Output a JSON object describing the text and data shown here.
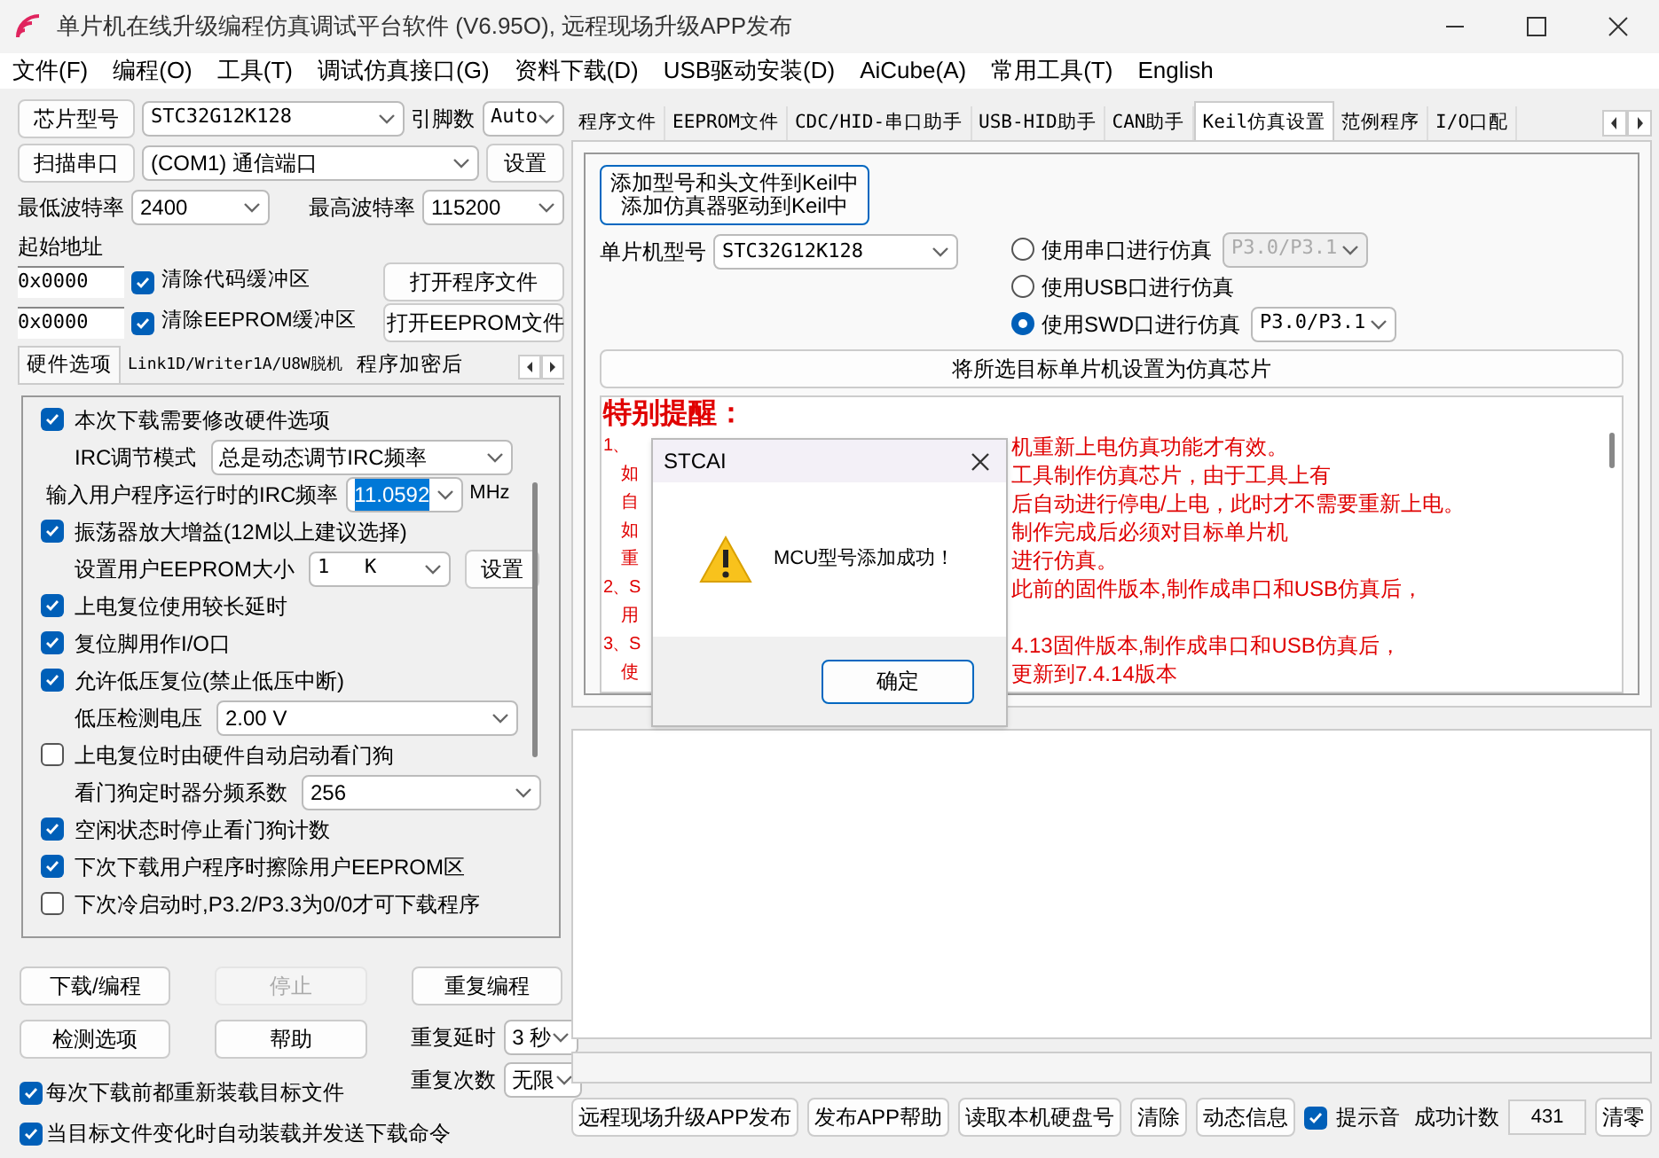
{
  "window": {
    "title": "单片机在线升级编程仿真调试平台软件 (V6.95O), 远程现场升级APP发布"
  },
  "menu": [
    "文件(F)",
    "编程(O)",
    "工具(T)",
    "调试仿真接口(G)",
    "资料下载(D)",
    "USB驱动安装(D)",
    "AiCube(A)",
    "常用工具(T)",
    "English"
  ],
  "chip": {
    "button": "芯片型号",
    "value": "STC32G12K128",
    "pins_label": "引脚数",
    "pins_value": "Auto"
  },
  "port": {
    "button": "扫描串口",
    "value": "(COM1) 通信端口",
    "settings": "设置"
  },
  "baud": {
    "min_label": "最低波特率",
    "min": "2400",
    "max_label": "最高波特率",
    "max": "115200"
  },
  "start_address": {
    "label": "起始地址",
    "rows": [
      {
        "value": "0x0000",
        "checked": true,
        "label": "清除代码缓冲区",
        "button": "打开程序文件"
      },
      {
        "value": "0x0000",
        "checked": true,
        "label": "清除EEPROM缓冲区",
        "button": "打开EEPROM文件"
      }
    ]
  },
  "left_tabs": [
    {
      "label": "硬件选项",
      "selected": true
    },
    {
      "label": "Link1D/Writer1A/U8W脱机",
      "selected": false
    },
    {
      "label": "程序加密后",
      "selected": false
    }
  ],
  "options": [
    {
      "kind": "check",
      "label": "本次下载需要修改硬件选项",
      "checked": true
    },
    {
      "kind": "select",
      "label": "IRC调节模式",
      "value": "总是动态调节IRC频率"
    },
    {
      "kind": "freq",
      "label": "输入用户程序运行时的IRC频率",
      "value": "11.0592",
      "unit": "MHz"
    },
    {
      "kind": "check",
      "label": "振荡器放大增益(12M以上建议选择)",
      "checked": true
    },
    {
      "kind": "select_button",
      "label": "设置用户EEPROM大小",
      "value": "1   K",
      "button": "设置"
    },
    {
      "kind": "check",
      "label": "上电复位使用较长延时",
      "checked": true
    },
    {
      "kind": "check",
      "label": "复位脚用作I/O口",
      "checked": true
    },
    {
      "kind": "check",
      "label": "允许低压复位(禁止低压中断)",
      "checked": true
    },
    {
      "kind": "select",
      "label": "低压检测电压",
      "value": "2.00 V"
    },
    {
      "kind": "check",
      "label": "上电复位时由硬件自动启动看门狗",
      "checked": false
    },
    {
      "kind": "select",
      "label": "看门狗定时器分频系数",
      "value": "256"
    },
    {
      "kind": "check",
      "label": "空闲状态时停止看门狗计数",
      "checked": true
    },
    {
      "kind": "check",
      "label": "下次下载用户程序时擦除用户EEPROM区",
      "checked": true
    },
    {
      "kind": "check",
      "label": "下次冷启动时,P3.2/P3.3为0/0才可下载程序",
      "checked": false
    }
  ],
  "actions": [
    {
      "label": "下载/编程",
      "disabled": false
    },
    {
      "label": "停止",
      "disabled": true
    },
    {
      "label": "重复编程",
      "disabled": false
    },
    {
      "label": "检测选项",
      "disabled": false
    },
    {
      "label": "帮助",
      "disabled": false
    }
  ],
  "repeat": {
    "delay_label": "重复延时",
    "delay": "3 秒",
    "count_label": "重复次数",
    "count": "无限"
  },
  "reload_options": [
    {
      "label": "每次下载前都重新装载目标文件",
      "checked": true
    },
    {
      "label": "当目标文件变化时自动装载并发送下载命令",
      "checked": true
    }
  ],
  "right_tabs": [
    {
      "label": "程序文件",
      "selected": false
    },
    {
      "label": "EEPROM文件",
      "selected": false
    },
    {
      "label": "CDC/HID-串口助手",
      "selected": false
    },
    {
      "label": "USB-HID助手",
      "selected": false
    },
    {
      "label": "CAN助手",
      "selected": false
    },
    {
      "label": "Keil仿真设置",
      "selected": true
    },
    {
      "label": "范例程序",
      "selected": false
    },
    {
      "label": "I/O口配",
      "selected": false
    }
  ],
  "keil": {
    "add_button": [
      "添加型号和头文件到Keil中",
      "添加仿真器驱动到Keil中"
    ],
    "mcu_label": "单片机型号",
    "mcu_value": "STC32G12K128",
    "modes": [
      {
        "label": "使用串口进行仿真",
        "selected": false,
        "pins": "P3.0/P3.1",
        "disabled": true
      },
      {
        "label": "使用USB口进行仿真",
        "selected": false
      },
      {
        "label": "使用SWD口进行仿真",
        "selected": true,
        "pins": "P3.0/P3.1",
        "disabled": false
      }
    ],
    "set_button": "将所选目标单片机设置为仿真芯片",
    "notice_title": "特别提醒：",
    "notice_lines": [
      [
        "1、",
        "机重新上电仿真功能才有效。"
      ],
      [
        "如",
        "工具制作仿真芯片，由于工具上有"
      ],
      [
        "自",
        "后自动进行停电/上电，此时才不需要重新上电。"
      ],
      [
        "如",
        "制作完成后必须对目标单片机"
      ],
      [
        "重",
        "进行仿真。"
      ],
      [
        "2、S",
        "此前的固件版本,制作成串口和USB仿真后，"
      ],
      [
        "用"
      ],
      [
        "3、S",
        "4.13固件版本,制作成串口和USB仿真后，"
      ],
      [
        "使",
        "更新到7.4.14版本"
      ]
    ]
  },
  "bottom_buttons": [
    "远程现场升级APP发布",
    "发布APP帮助",
    "读取本机硬盘号",
    "清除",
    "动态信息"
  ],
  "sound": {
    "label": "提示音",
    "checked": true
  },
  "success": {
    "label": "成功计数",
    "value": "431",
    "reset": "清零"
  },
  "dialog": {
    "title": "STCAI",
    "message": "MCU型号添加成功！",
    "ok": "确定"
  }
}
